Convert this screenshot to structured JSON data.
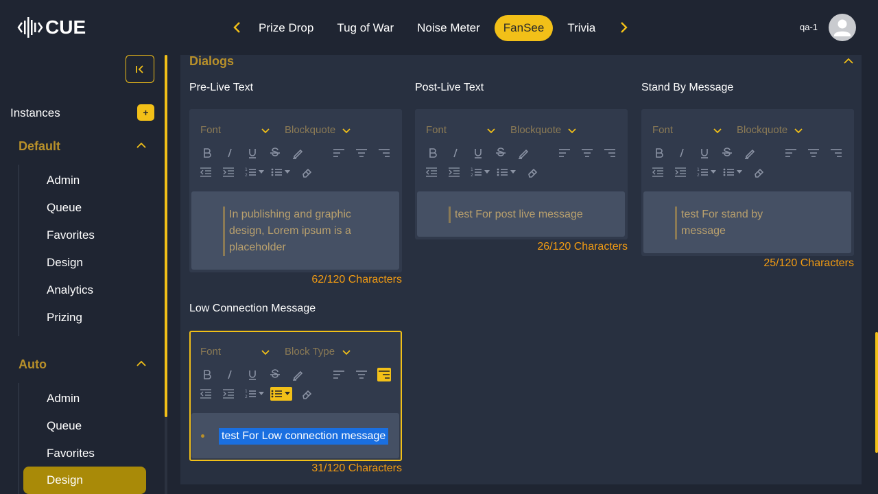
{
  "app": {
    "logo_text": "CUE",
    "user": "qa-1"
  },
  "nav": {
    "tabs": [
      {
        "label": "Prize Drop",
        "active": false
      },
      {
        "label": "Tug of War",
        "active": false
      },
      {
        "label": "Noise Meter",
        "active": false
      },
      {
        "label": "FanSee",
        "active": true
      },
      {
        "label": "Trivia",
        "active": false
      }
    ]
  },
  "sidebar": {
    "instances_label": "Instances",
    "add_label": "+",
    "groups": [
      {
        "title": "Default",
        "items": [
          "Admin",
          "Queue",
          "Favorites",
          "Design",
          "Analytics",
          "Prizing"
        ]
      },
      {
        "title": "Auto",
        "items": [
          "Admin",
          "Queue",
          "Favorites",
          "Design"
        ],
        "active_item": "Design"
      }
    ]
  },
  "main": {
    "section_title": "Dialogs",
    "editors": [
      {
        "label": "Pre-Live Text",
        "font": "Font",
        "block": "Blockquote",
        "content": "In publishing and graphic design, Lorem ipsum is a placeholder",
        "lines": [
          " In publishing and graphic",
          "design, Lorem ipsum is a",
          "placeholder"
        ],
        "count": "62/120 Characters"
      },
      {
        "label": "Post-Live Text",
        "font": "Font",
        "block": "Blockquote",
        "lines": [
          "test For post live message"
        ],
        "count": "26/120 Characters"
      },
      {
        "label": "Stand By Message",
        "font": "Font",
        "block": "Blockquote",
        "lines": [
          " test For stand by",
          "message"
        ],
        "count": "25/120 Characters"
      },
      {
        "label": "Low Connection Message",
        "font": "Font",
        "block": "Block Type",
        "lines": [
          "test For Low connection message"
        ],
        "count": "31/120 Characters",
        "focused": true
      }
    ]
  },
  "colors": {
    "accent": "#f2c018",
    "bg": "#1f2532",
    "panel": "#283040",
    "count": "#f39c12",
    "selection": "#1a6fe0"
  },
  "icons": [
    "chevron-left-icon",
    "chevron-right-icon",
    "collapse-icon",
    "bold-icon",
    "italic-icon",
    "underline-icon",
    "strikethrough-icon",
    "highlight-icon",
    "align-left-icon",
    "align-center-icon",
    "align-right-icon",
    "outdent-icon",
    "indent-icon",
    "ordered-list-icon",
    "unordered-list-icon",
    "eraser-icon",
    "user-avatar-icon"
  ]
}
